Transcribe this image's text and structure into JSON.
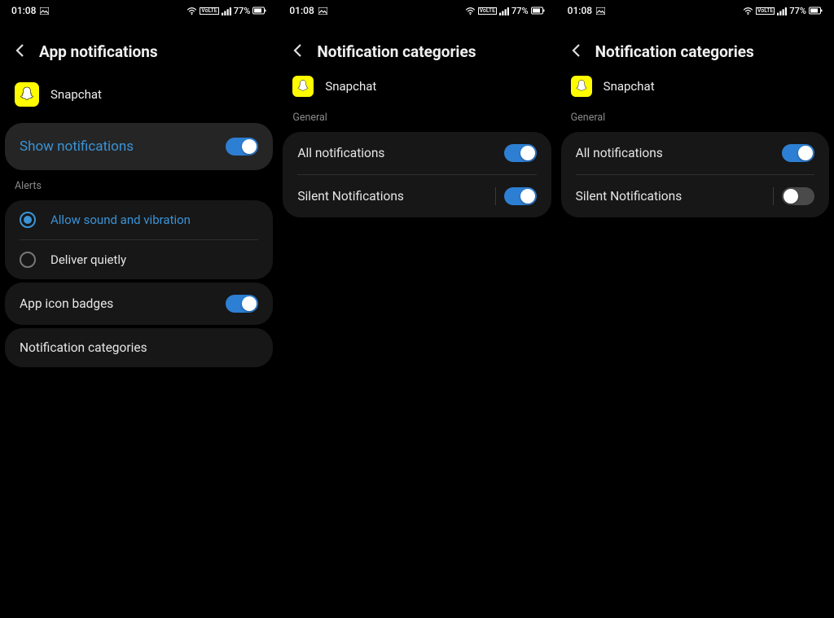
{
  "status": {
    "time": "01:08",
    "lte_label": "VoLTE",
    "battery": "77%"
  },
  "screen1": {
    "title": "App notifications",
    "app_name": "Snapchat",
    "show_notifications": "Show notifications",
    "alerts_label": "Alerts",
    "allow_sound": "Allow sound and vibration",
    "deliver_quietly": "Deliver quietly",
    "app_icon_badges": "App icon badges",
    "notification_categories": "Notification categories"
  },
  "screen2": {
    "title": "Notification categories",
    "app_name": "Snapchat",
    "general_label": "General",
    "all_notifications": "All notifications",
    "silent_notifications": "Silent Notifications",
    "silent_on": true
  },
  "screen3": {
    "title": "Notification categories",
    "app_name": "Snapchat",
    "general_label": "General",
    "all_notifications": "All notifications",
    "silent_notifications": "Silent Notifications",
    "silent_on": false
  }
}
